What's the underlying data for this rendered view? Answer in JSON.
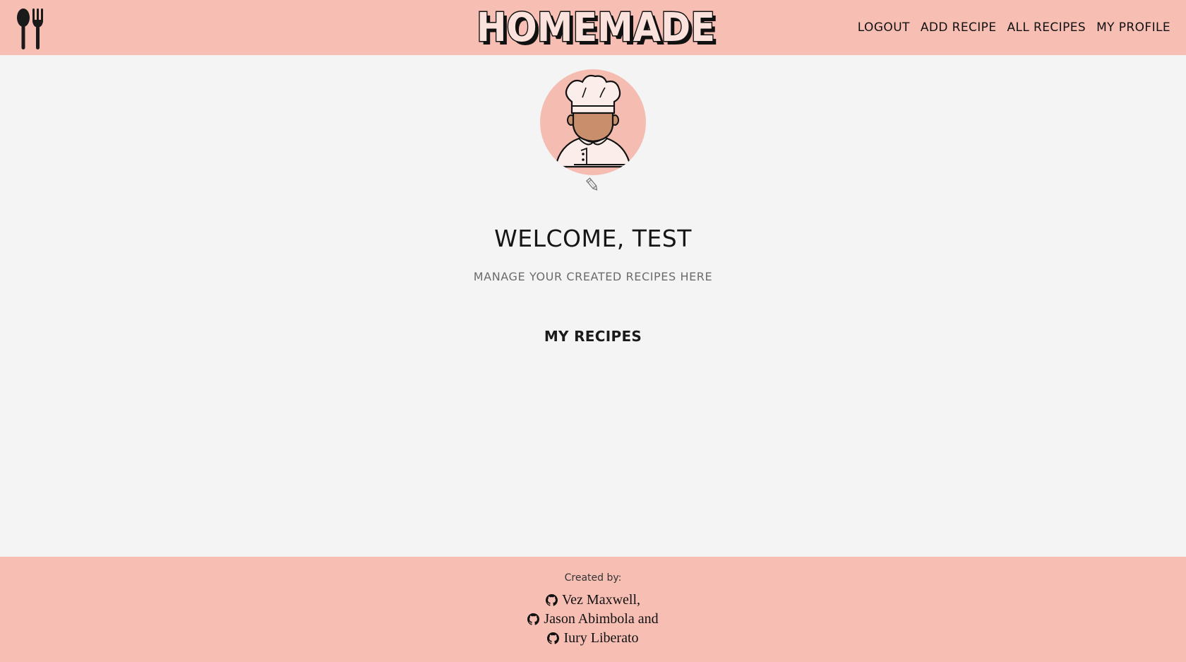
{
  "brand": {
    "logo_text": "HOMEMADE",
    "utensils_icon": "spoon-fork-icon"
  },
  "nav": {
    "items": [
      {
        "label": "LOGOUT"
      },
      {
        "label": "ADD RECIPE"
      },
      {
        "label": "ALL RECIPES"
      },
      {
        "label": "MY PROFILE"
      }
    ]
  },
  "profile": {
    "avatar_icon": "chef-avatar",
    "edit_icon": "pencil-icon",
    "welcome": "WELCOME, TEST",
    "subtitle": "MANAGE YOUR CREATED RECIPES HERE",
    "section_title": "MY RECIPES"
  },
  "footer": {
    "created_by": "Created by:",
    "authors": [
      {
        "name": "Vez Maxwell,",
        "icon": "github-icon"
      },
      {
        "name": "Jason Abimbola and",
        "icon": "github-icon"
      },
      {
        "name": "Iury Liberato",
        "icon": "github-icon"
      }
    ]
  },
  "colors": {
    "header_bg": "#f7bfb4",
    "page_bg": "#f4f4f4",
    "text": "#1a1a1a",
    "muted": "#6b6b6b",
    "avatar_bg": "#f5bdb2",
    "skin": "#c98f6c"
  }
}
